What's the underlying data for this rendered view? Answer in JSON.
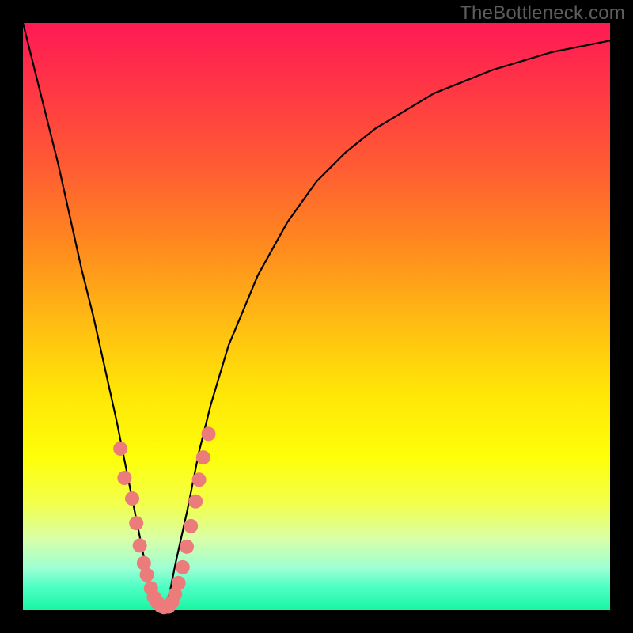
{
  "watermark": "TheBottleneck.com",
  "chart_data": {
    "type": "line",
    "title": "",
    "xlabel": "",
    "ylabel": "",
    "xlim": [
      0,
      100
    ],
    "ylim": [
      0,
      100
    ],
    "x": [
      0,
      2,
      4,
      6,
      8,
      10,
      12,
      14,
      16,
      18,
      19,
      20,
      21,
      22,
      23,
      24,
      25,
      26,
      28,
      30,
      32,
      35,
      40,
      45,
      50,
      55,
      60,
      65,
      70,
      75,
      80,
      85,
      90,
      95,
      100
    ],
    "y": [
      100,
      92,
      84,
      76,
      67,
      58,
      50,
      41,
      32,
      22,
      17,
      12,
      7,
      3,
      0,
      0,
      3,
      8,
      17,
      27,
      35,
      45,
      57,
      66,
      73,
      78,
      82,
      85,
      88,
      90,
      92,
      93.5,
      95,
      96,
      97
    ],
    "marker_points_x": [
      16.6,
      17.3,
      18.6,
      19.3,
      19.9,
      20.6,
      21.1,
      21.8,
      22.3,
      22.9,
      23.5,
      24.0,
      24.8,
      25.4,
      25.9,
      26.5,
      27.2,
      27.9,
      28.6,
      29.4,
      30.0,
      30.7,
      31.6
    ],
    "marker_points_y": [
      27.5,
      22.5,
      19.0,
      14.8,
      11.0,
      8.0,
      6.0,
      3.7,
      2.2,
      1.3,
      0.7,
      0.5,
      0.6,
      1.4,
      2.7,
      4.6,
      7.3,
      10.8,
      14.3,
      18.5,
      22.2,
      26.0,
      30.0
    ],
    "curve_stroke": "#000000",
    "marker_fill": "#ec7b7b",
    "marker_radius_px": 9
  }
}
